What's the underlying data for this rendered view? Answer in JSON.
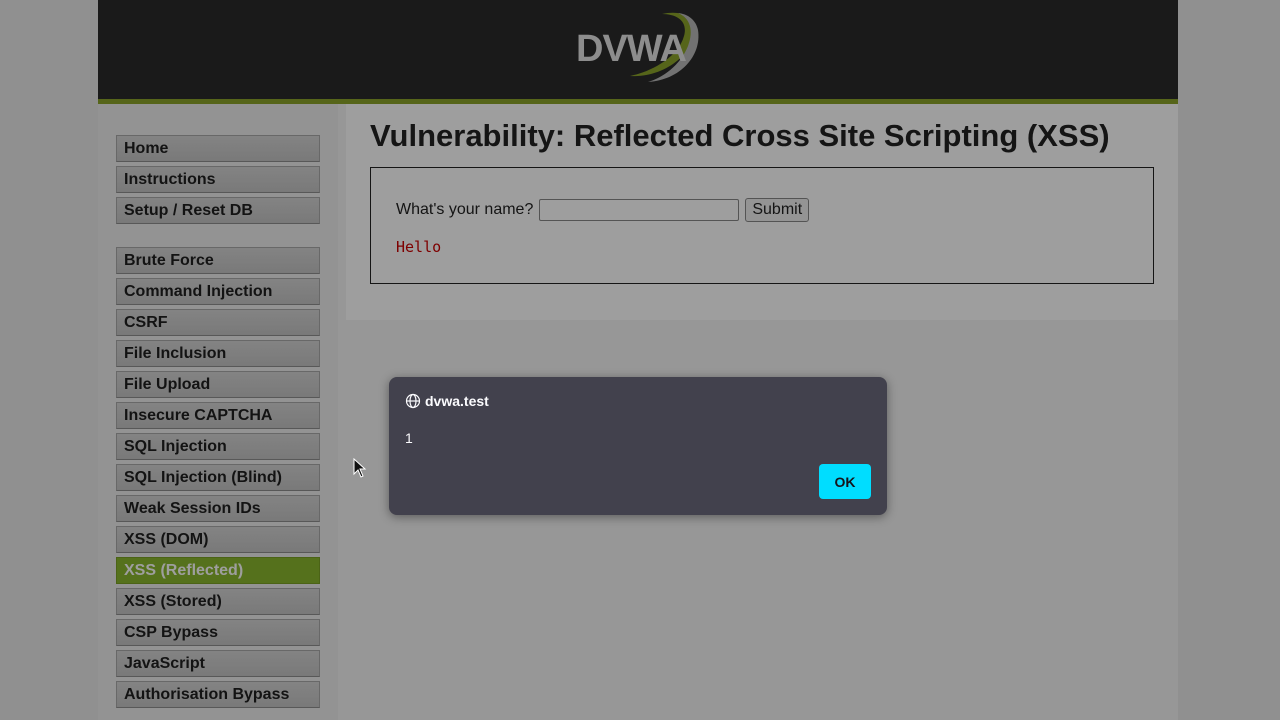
{
  "header": {
    "logo_text": "DVWA"
  },
  "sidebar": {
    "top_items": [
      {
        "label": "Home"
      },
      {
        "label": "Instructions"
      },
      {
        "label": "Setup / Reset DB"
      }
    ],
    "vuln_items": [
      {
        "label": "Brute Force"
      },
      {
        "label": "Command Injection"
      },
      {
        "label": "CSRF"
      },
      {
        "label": "File Inclusion"
      },
      {
        "label": "File Upload"
      },
      {
        "label": "Insecure CAPTCHA"
      },
      {
        "label": "SQL Injection"
      },
      {
        "label": "SQL Injection (Blind)"
      },
      {
        "label": "Weak Session IDs"
      },
      {
        "label": "XSS (DOM)"
      },
      {
        "label": "XSS (Reflected)"
      },
      {
        "label": "XSS (Stored)"
      },
      {
        "label": "CSP Bypass"
      },
      {
        "label": "JavaScript"
      },
      {
        "label": "Authorisation Bypass"
      }
    ],
    "active_item": "XSS (Reflected)"
  },
  "main": {
    "title": "Vulnerability: Reflected Cross Site Scripting (XSS)",
    "form": {
      "label": "What's your name?",
      "input_value": "",
      "submit_label": "Submit"
    },
    "output": "Hello"
  },
  "alert": {
    "origin": "dvwa.test",
    "message": "1",
    "ok_label": "OK"
  },
  "colors": {
    "accent_green": "#8ab72e",
    "header_bg": "#2a2a2a",
    "dialog_bg": "#42414d",
    "ok_button": "#00ddff",
    "output_red": "#cc0000"
  }
}
